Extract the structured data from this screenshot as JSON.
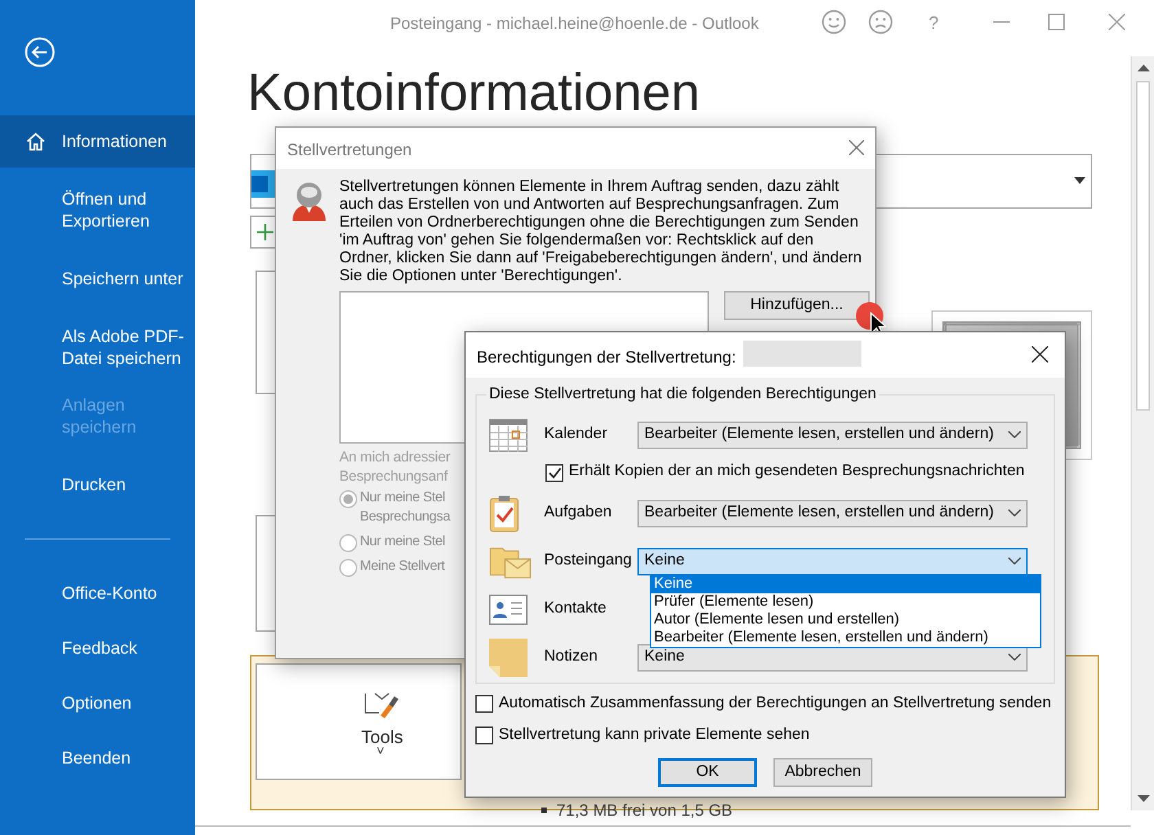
{
  "window": {
    "title": "Posteingang - michael.heine@hoenle.de  -  Outlook",
    "help": "?"
  },
  "sidebar": {
    "groups": [
      [
        {
          "label": "Informationen",
          "selected": true,
          "disabled": false
        },
        {
          "label": "Öffnen und Exportieren",
          "selected": false,
          "disabled": false
        },
        {
          "label": "Speichern unter",
          "selected": false,
          "disabled": false
        },
        {
          "label": "Als Adobe PDF-Datei speichern",
          "selected": false,
          "disabled": false
        },
        {
          "label": "Anlagen speichern",
          "selected": false,
          "disabled": true
        },
        {
          "label": "Drucken",
          "selected": false,
          "disabled": false
        }
      ],
      [
        {
          "label": "Office-Konto",
          "selected": false,
          "disabled": false
        },
        {
          "label": "Feedback",
          "selected": false,
          "disabled": false
        },
        {
          "label": "Optionen",
          "selected": false,
          "disabled": false
        },
        {
          "label": "Beenden",
          "selected": false,
          "disabled": false
        }
      ]
    ]
  },
  "page": {
    "heading": "Kontoinformationen",
    "tools_label": "Tools",
    "tools_caret": "˅",
    "storage_text": "71,3 MB frei von 1,5 GB"
  },
  "delegates_dialog": {
    "title": "Stellvertretungen",
    "description": "Stellvertretungen können Elemente in Ihrem Auftrag senden, dazu zählt auch das Erstellen von und Antworten auf Besprechungsanfragen. Zum Erteilen von Ordnerberechtigungen ohne die Berechtigungen zum Senden 'im Auftrag von' gehen Sie folgendermaßen vor: Rechtsklick auf den Ordner, klicken Sie dann auf 'Freigabeberechtigungen ändern', und ändern Sie die Optionen unter 'Berechtigungen'.",
    "add_button": "Hinzufügen...",
    "delivery_label": [
      "An mich adressier",
      "Besprechungsanf"
    ],
    "options": [
      {
        "lines": [
          "Nur meine Stel",
          "Besprechungsa"
        ],
        "selected": true
      },
      {
        "lines": [
          "Nur meine Stel"
        ],
        "selected": false
      },
      {
        "lines": [
          "Meine Stellvert"
        ],
        "selected": false
      }
    ]
  },
  "permissions_dialog": {
    "title": "Berechtigungen der Stellvertretung:",
    "group_title": "Diese Stellvertretung hat die folgenden Berechtigungen",
    "rows": [
      {
        "kind": "calendar",
        "label": "Kalender",
        "value": "Bearbeiter (Elemente lesen, erstellen und ändern)",
        "open": false
      },
      {
        "kind": "checkbox",
        "label": "Erhält Kopien der an mich gesendeten Besprechungsnachrichten",
        "checked": true
      },
      {
        "kind": "tasks",
        "label": "Aufgaben",
        "value": "Bearbeiter (Elemente lesen, erstellen und ändern)",
        "open": false
      },
      {
        "kind": "inbox",
        "label": "Posteingang",
        "value": "Keine",
        "open": true,
        "options": [
          {
            "label": "Keine",
            "selected": true
          },
          {
            "label": "Prüfer (Elemente lesen)",
            "selected": false
          },
          {
            "label": "Autor (Elemente lesen und erstellen)",
            "selected": false
          },
          {
            "label": "Bearbeiter (Elemente lesen, erstellen und ändern)",
            "selected": false
          }
        ]
      },
      {
        "kind": "contacts",
        "label": "Kontakte"
      },
      {
        "kind": "notes",
        "label": "Notizen",
        "value": "Keine",
        "open": false
      }
    ],
    "checkboxes": [
      {
        "label": "Automatisch Zusammenfassung der Berechtigungen an Stellvertretung senden",
        "checked": false
      },
      {
        "label": "Stellvertretung kann private Elemente sehen",
        "checked": false
      }
    ],
    "buttons": [
      {
        "label": "OK",
        "default": true
      },
      {
        "label": "Abbrechen",
        "default": false
      }
    ]
  }
}
